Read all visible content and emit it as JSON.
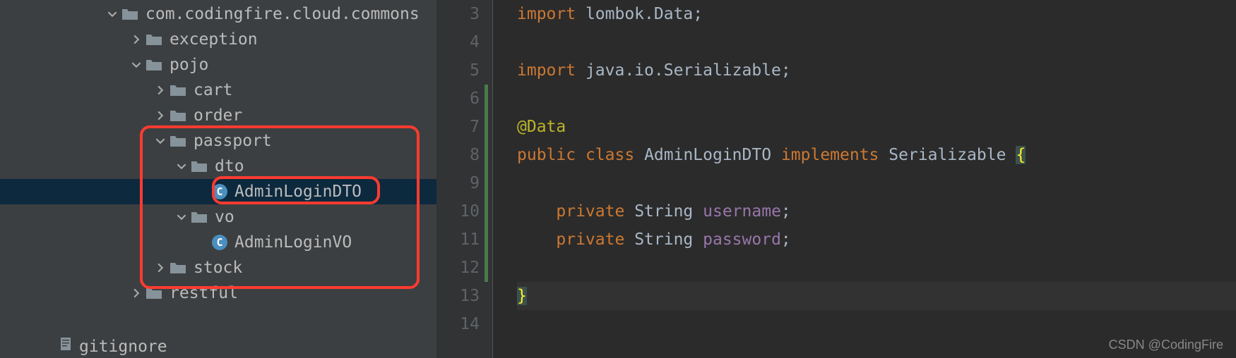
{
  "sidebar": {
    "items": [
      {
        "label": "com.codingfire.cloud.commons",
        "type": "folder",
        "expanded": true,
        "indent": 0
      },
      {
        "label": "exception",
        "type": "folder",
        "expanded": false,
        "indent": 1
      },
      {
        "label": "pojo",
        "type": "folder",
        "expanded": true,
        "indent": 1
      },
      {
        "label": "cart",
        "type": "folder",
        "expanded": false,
        "indent": 2
      },
      {
        "label": "order",
        "type": "folder",
        "expanded": false,
        "indent": 2
      },
      {
        "label": "passport",
        "type": "folder",
        "expanded": true,
        "indent": 2
      },
      {
        "label": "dto",
        "type": "folder",
        "expanded": true,
        "indent": 3
      },
      {
        "label": "AdminLoginDTO",
        "type": "class",
        "indent": 4,
        "selected": true
      },
      {
        "label": "vo",
        "type": "folder",
        "expanded": true,
        "indent": 3
      },
      {
        "label": "AdminLoginVO",
        "type": "class",
        "indent": 4
      },
      {
        "label": "stock",
        "type": "folder",
        "expanded": false,
        "indent": 2
      },
      {
        "label": "restful",
        "type": "folder",
        "expanded": false,
        "indent": 1
      }
    ],
    "bottom_file": "gitignore"
  },
  "gutter": {
    "lines": [
      "3",
      "4",
      "5",
      "6",
      "7",
      "8",
      "9",
      "10",
      "11",
      "12",
      "13",
      "14"
    ]
  },
  "code": {
    "l3_import": "import",
    "l3_rest": " lombok.Data;",
    "l5_import": "import",
    "l5_rest": " java.io.Serializable;",
    "l7_anno": "@Data",
    "l8_public": "public",
    "l8_class": "class",
    "l8_name": "AdminLoginDTO",
    "l8_impl": "implements",
    "l8_intf": "Serializable",
    "l8_brace": "{",
    "l10_pre": "    ",
    "l10_priv": "private",
    "l10_type": "String",
    "l10_var": "username",
    "l10_semi": ";",
    "l11_priv": "private",
    "l11_type": "String",
    "l11_var": "password",
    "l11_semi": ";",
    "l13_brace": "}"
  },
  "watermark": "CSDN @CodingFire"
}
